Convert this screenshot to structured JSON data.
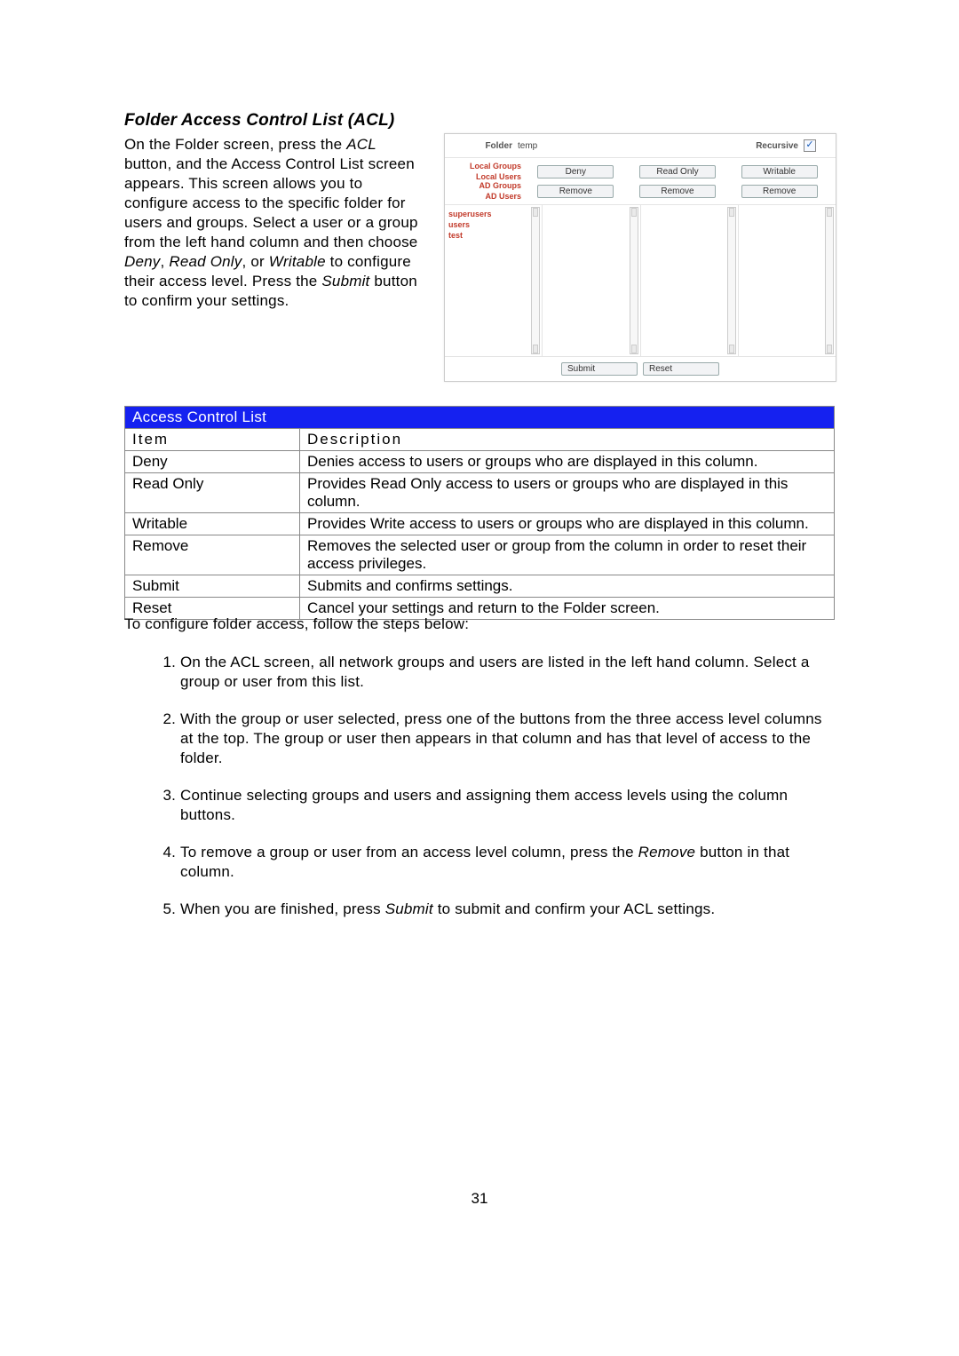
{
  "heading": "Folder Access Control List (ACL)",
  "intro": {
    "seg1": "On the Folder screen, press the ",
    "acl": "ACL",
    "seg2": " button, and the Access Control List screen appears. This screen allows you to configure access to the specific folder for users and groups. Select a user or a group from the left hand column and then choose ",
    "deny": "Deny",
    "comma1": ", ",
    "readonly": "Read Only",
    "comma2": ", or ",
    "writable": "Writable",
    "seg3": " to configure their access level. Press the ",
    "submit": "Submit",
    "seg4": " button to confirm your settings."
  },
  "shot": {
    "folder_label": "Folder",
    "folder_value": "temp",
    "recursive_label": "Recursive",
    "side_labels": [
      "Local Groups",
      "Local Users",
      "AD Groups",
      "AD Users"
    ],
    "col_buttons": [
      "Deny",
      "Read Only",
      "Writable"
    ],
    "remove_label": "Remove",
    "list_items": [
      "superusers",
      "users",
      "test"
    ],
    "submit": "Submit",
    "reset": "Reset"
  },
  "table": {
    "title": "Access Control List",
    "header_item": "Item",
    "header_desc": "Description",
    "rows": [
      {
        "item": "Deny",
        "desc": "Denies access to users or groups who are displayed in this column."
      },
      {
        "item": "Read Only",
        "desc": "Provides Read Only access to users or groups who are displayed in this column."
      },
      {
        "item": "Writable",
        "desc": "Provides Write access to users or groups who are displayed in this column."
      },
      {
        "item": "Remove",
        "desc": "Removes the selected user or group from the column in order to reset their access privileges."
      },
      {
        "item": "Submit",
        "desc": "Submits and confirms settings."
      },
      {
        "item": "Reset",
        "desc": "Cancel your settings and return to the Folder screen."
      }
    ]
  },
  "followup": "To configure folder access, follow the steps below:",
  "steps": {
    "s1": "On the ACL screen, all network groups and users are listed in the left hand column. Select a group or user from this list.",
    "s2": "With the group or user selected, press one of the buttons from the three access level columns at the top. The group or user then appears in that column and has that level of access to the folder.",
    "s3": "Continue selecting groups and users and assigning them access levels using the column buttons.",
    "s4a": "To remove a group or user from an access level column, press the ",
    "s4_remove": "Remove",
    "s4b": " button in that column.",
    "s5a": "When you are finished, press ",
    "s5_submit": "Submit",
    "s5b": " to submit and confirm your ACL settings."
  },
  "page_number": "31"
}
